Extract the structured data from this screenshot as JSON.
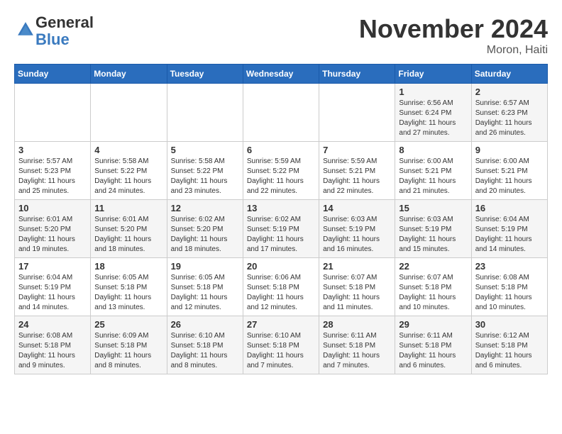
{
  "logo": {
    "general": "General",
    "blue": "Blue"
  },
  "header": {
    "month": "November 2024",
    "location": "Moron, Haiti"
  },
  "days_of_week": [
    "Sunday",
    "Monday",
    "Tuesday",
    "Wednesday",
    "Thursday",
    "Friday",
    "Saturday"
  ],
  "weeks": [
    [
      {
        "day": "",
        "info": ""
      },
      {
        "day": "",
        "info": ""
      },
      {
        "day": "",
        "info": ""
      },
      {
        "day": "",
        "info": ""
      },
      {
        "day": "",
        "info": ""
      },
      {
        "day": "1",
        "info": "Sunrise: 6:56 AM\nSunset: 6:24 PM\nDaylight: 11 hours and 27 minutes."
      },
      {
        "day": "2",
        "info": "Sunrise: 6:57 AM\nSunset: 6:23 PM\nDaylight: 11 hours and 26 minutes."
      }
    ],
    [
      {
        "day": "3",
        "info": "Sunrise: 5:57 AM\nSunset: 5:23 PM\nDaylight: 11 hours and 25 minutes."
      },
      {
        "day": "4",
        "info": "Sunrise: 5:58 AM\nSunset: 5:22 PM\nDaylight: 11 hours and 24 minutes."
      },
      {
        "day": "5",
        "info": "Sunrise: 5:58 AM\nSunset: 5:22 PM\nDaylight: 11 hours and 23 minutes."
      },
      {
        "day": "6",
        "info": "Sunrise: 5:59 AM\nSunset: 5:22 PM\nDaylight: 11 hours and 22 minutes."
      },
      {
        "day": "7",
        "info": "Sunrise: 5:59 AM\nSunset: 5:21 PM\nDaylight: 11 hours and 22 minutes."
      },
      {
        "day": "8",
        "info": "Sunrise: 6:00 AM\nSunset: 5:21 PM\nDaylight: 11 hours and 21 minutes."
      },
      {
        "day": "9",
        "info": "Sunrise: 6:00 AM\nSunset: 5:21 PM\nDaylight: 11 hours and 20 minutes."
      }
    ],
    [
      {
        "day": "10",
        "info": "Sunrise: 6:01 AM\nSunset: 5:20 PM\nDaylight: 11 hours and 19 minutes."
      },
      {
        "day": "11",
        "info": "Sunrise: 6:01 AM\nSunset: 5:20 PM\nDaylight: 11 hours and 18 minutes."
      },
      {
        "day": "12",
        "info": "Sunrise: 6:02 AM\nSunset: 5:20 PM\nDaylight: 11 hours and 18 minutes."
      },
      {
        "day": "13",
        "info": "Sunrise: 6:02 AM\nSunset: 5:19 PM\nDaylight: 11 hours and 17 minutes."
      },
      {
        "day": "14",
        "info": "Sunrise: 6:03 AM\nSunset: 5:19 PM\nDaylight: 11 hours and 16 minutes."
      },
      {
        "day": "15",
        "info": "Sunrise: 6:03 AM\nSunset: 5:19 PM\nDaylight: 11 hours and 15 minutes."
      },
      {
        "day": "16",
        "info": "Sunrise: 6:04 AM\nSunset: 5:19 PM\nDaylight: 11 hours and 14 minutes."
      }
    ],
    [
      {
        "day": "17",
        "info": "Sunrise: 6:04 AM\nSunset: 5:19 PM\nDaylight: 11 hours and 14 minutes."
      },
      {
        "day": "18",
        "info": "Sunrise: 6:05 AM\nSunset: 5:18 PM\nDaylight: 11 hours and 13 minutes."
      },
      {
        "day": "19",
        "info": "Sunrise: 6:05 AM\nSunset: 5:18 PM\nDaylight: 11 hours and 12 minutes."
      },
      {
        "day": "20",
        "info": "Sunrise: 6:06 AM\nSunset: 5:18 PM\nDaylight: 11 hours and 12 minutes."
      },
      {
        "day": "21",
        "info": "Sunrise: 6:07 AM\nSunset: 5:18 PM\nDaylight: 11 hours and 11 minutes."
      },
      {
        "day": "22",
        "info": "Sunrise: 6:07 AM\nSunset: 5:18 PM\nDaylight: 11 hours and 10 minutes."
      },
      {
        "day": "23",
        "info": "Sunrise: 6:08 AM\nSunset: 5:18 PM\nDaylight: 11 hours and 10 minutes."
      }
    ],
    [
      {
        "day": "24",
        "info": "Sunrise: 6:08 AM\nSunset: 5:18 PM\nDaylight: 11 hours and 9 minutes."
      },
      {
        "day": "25",
        "info": "Sunrise: 6:09 AM\nSunset: 5:18 PM\nDaylight: 11 hours and 8 minutes."
      },
      {
        "day": "26",
        "info": "Sunrise: 6:10 AM\nSunset: 5:18 PM\nDaylight: 11 hours and 8 minutes."
      },
      {
        "day": "27",
        "info": "Sunrise: 6:10 AM\nSunset: 5:18 PM\nDaylight: 11 hours and 7 minutes."
      },
      {
        "day": "28",
        "info": "Sunrise: 6:11 AM\nSunset: 5:18 PM\nDaylight: 11 hours and 7 minutes."
      },
      {
        "day": "29",
        "info": "Sunrise: 6:11 AM\nSunset: 5:18 PM\nDaylight: 11 hours and 6 minutes."
      },
      {
        "day": "30",
        "info": "Sunrise: 6:12 AM\nSunset: 5:18 PM\nDaylight: 11 hours and 6 minutes."
      }
    ]
  ]
}
